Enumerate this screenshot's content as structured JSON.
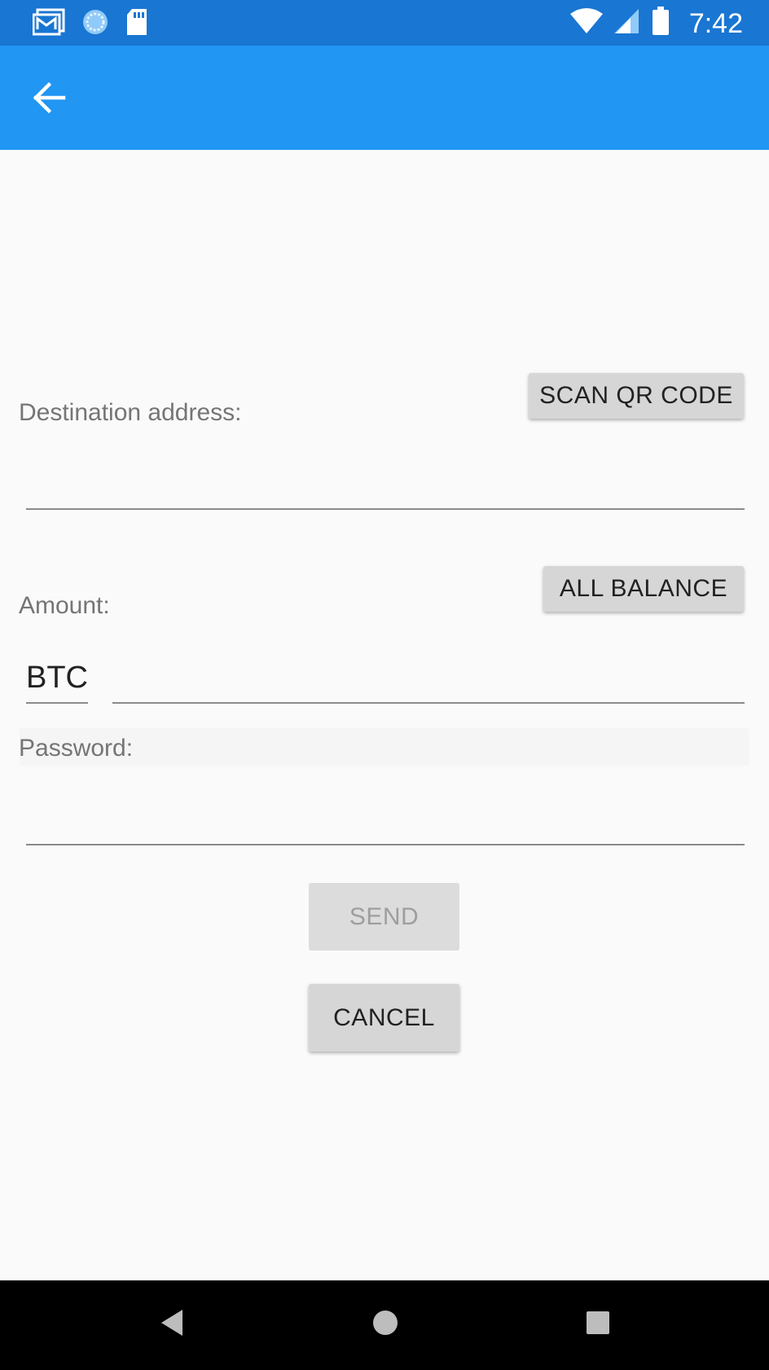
{
  "status_bar": {
    "time": "7:42",
    "icons": [
      "gmail-icon",
      "sync-icon",
      "sd-card-icon",
      "wifi-icon",
      "cell-signal-icon",
      "battery-icon"
    ]
  },
  "app_bar": {
    "back_icon": "arrow-back-icon",
    "color": "#2196f3"
  },
  "form": {
    "destination_label": "Destination address:",
    "scan_button": "SCAN QR CODE",
    "destination_value": "",
    "amount_label": "Amount:",
    "all_balance_button": "ALL BALANCE",
    "currency": "BTC",
    "amount_value": "",
    "password_label": "Password:",
    "password_value": "",
    "send_button": "SEND",
    "cancel_button": "CANCEL"
  },
  "nav_bar": {
    "back": "nav-back-icon",
    "home": "nav-home-icon",
    "recents": "nav-recents-icon"
  }
}
